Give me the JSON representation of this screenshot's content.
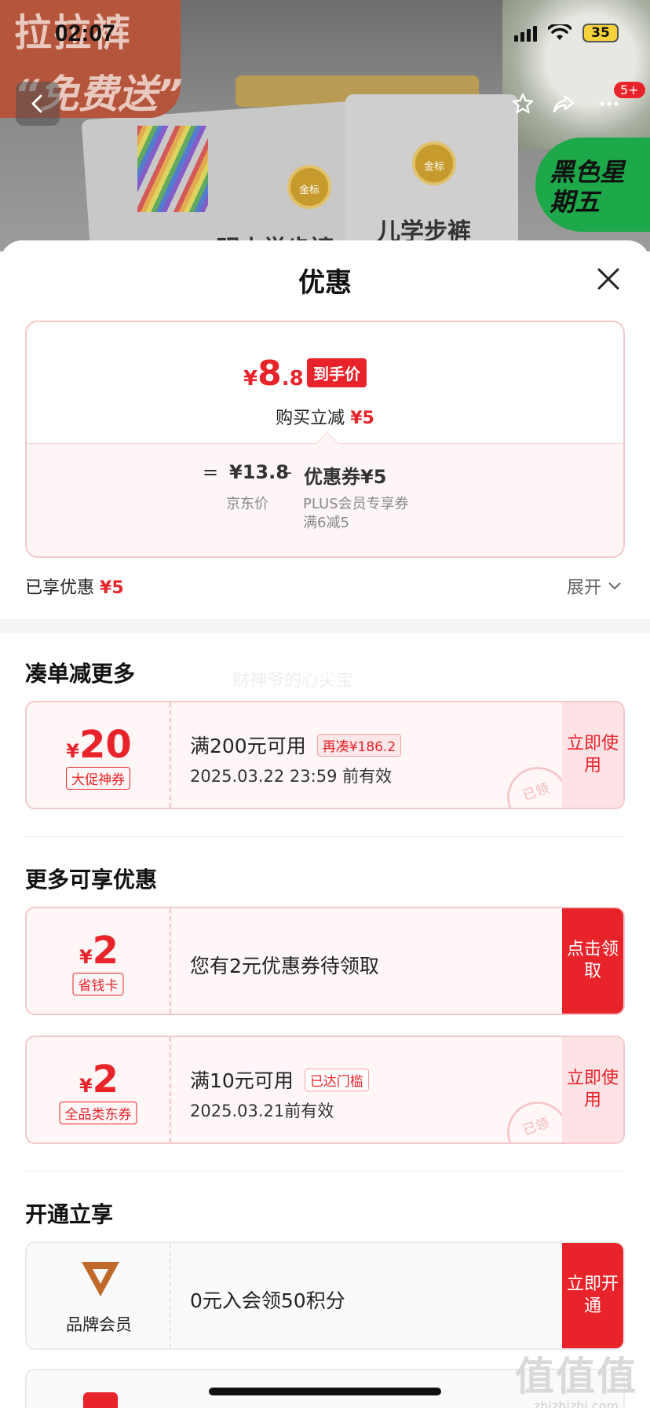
{
  "status_bar": {
    "time": "02:07",
    "battery": "35"
  },
  "background": {
    "promo_line1": "拉拉裤",
    "promo_line2": "“免费送”",
    "seal_text": "金标",
    "bag_label": "儿学步裤",
    "bag_label_left": "明小学步裤",
    "badge_text": "黑色星期五",
    "more_badge": "5+"
  },
  "sheet": {
    "title": "优惠",
    "final_price": {
      "symbol": "¥",
      "int": "8",
      "dec": ".8",
      "tag": "到手价"
    },
    "reduce": {
      "label": "购买立减",
      "value": "¥5"
    },
    "calc": {
      "eq": "=",
      "jd_price": "¥13.8",
      "minus": "–",
      "coupon": "优惠券¥5",
      "jd_label": "京东价",
      "plus_label": "PLUS会员专享券",
      "plus_rule": "满6减5"
    },
    "enjoyed": {
      "label": "已享优惠",
      "value": "¥5"
    },
    "expand": "展开"
  },
  "watermark": "财神爷的心尖宝",
  "sections": {
    "more_discount": "凑单减更多",
    "more_available": "更多可享优惠",
    "open_enjoy": "开通立享"
  },
  "coupons": [
    {
      "symbol": "¥",
      "amount": "20",
      "tag": "大促神券",
      "condition": "满200元可用",
      "pill": "再凑¥186.2",
      "validity": "2025.03.22 23:59 前有效",
      "action": "立即使用",
      "stamp": "已领"
    },
    {
      "symbol": "¥",
      "amount": "2",
      "tag": "省钱卡",
      "text": "您有2元优惠券待领取",
      "action": "点击领取"
    },
    {
      "symbol": "¥",
      "amount": "2",
      "tag": "全品类东券",
      "condition": "满10元可用",
      "pill": "已达门槛",
      "validity": "2025.03.21前有效",
      "action": "立即使用",
      "stamp": "已领"
    }
  ],
  "member": {
    "label": "品牌会员",
    "text": "0元入会领50积分",
    "action": "立即开通"
  },
  "corner_watermark": {
    "big": "值值值",
    "small": "zhizhizhi.com"
  }
}
